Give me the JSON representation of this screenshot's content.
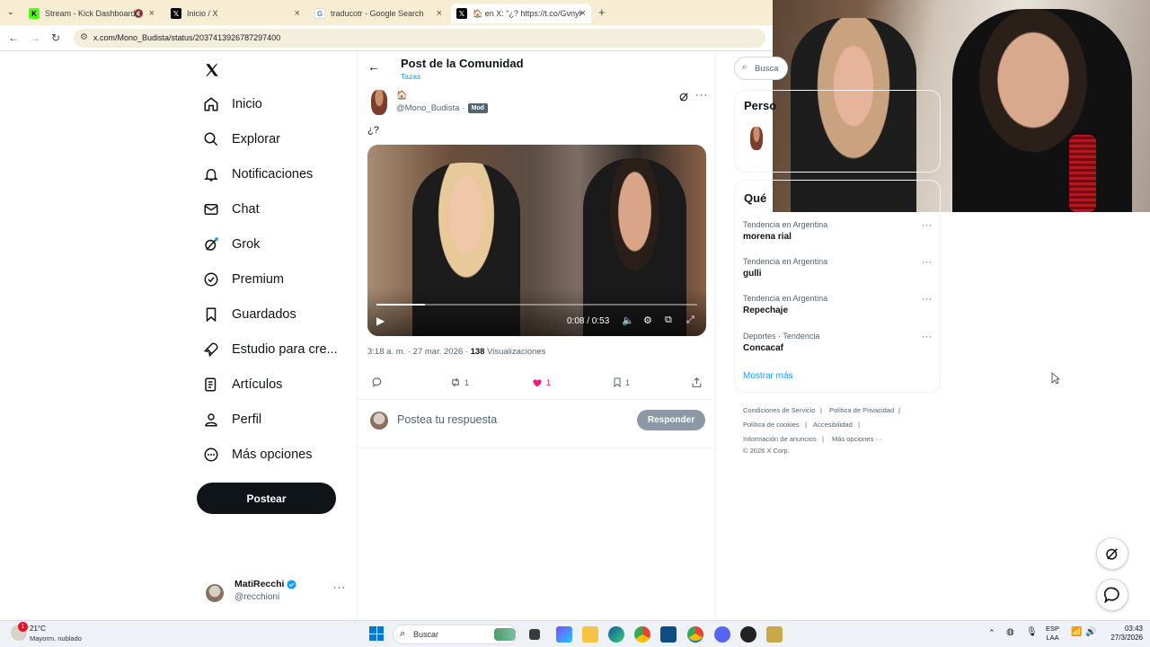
{
  "browser": {
    "tabs": [
      {
        "label": "Stream - Kick Dashboard",
        "favicon": "kick-icon"
      },
      {
        "label": "Inicio / X",
        "favicon": "x-icon"
      },
      {
        "label": "traducotr - Google Search",
        "favicon": "google-icon"
      },
      {
        "label": "🏠 en X: \"¿? https://t.co/GvnyK",
        "favicon": "x-icon"
      }
    ],
    "url": "x.com/Mono_Budista/status/2037413926787297400"
  },
  "nav": {
    "items": [
      {
        "label": "Inicio",
        "icon": "home-icon"
      },
      {
        "label": "Explorar",
        "icon": "search-icon"
      },
      {
        "label": "Notificaciones",
        "icon": "bell-icon"
      },
      {
        "label": "Chat",
        "icon": "mail-icon"
      },
      {
        "label": "Grok",
        "icon": "grok-icon"
      },
      {
        "label": "Premium",
        "icon": "verified-icon"
      },
      {
        "label": "Guardados",
        "icon": "bookmark-icon"
      },
      {
        "label": "Estudio para cre...",
        "icon": "rocket-icon"
      },
      {
        "label": "Artículos",
        "icon": "article-icon"
      },
      {
        "label": "Perfil",
        "icon": "person-icon"
      },
      {
        "label": "Más opciones",
        "icon": "more-circle-icon"
      }
    ],
    "post_button": "Postear",
    "account": {
      "name": "MatiRecchi",
      "handle": "@recchioni",
      "verified": true
    }
  },
  "header": {
    "title": "Post de la Comunidad",
    "community": "Tazas"
  },
  "post": {
    "name_glyph": "🏠",
    "handle": "@Mono_Budista",
    "separator": "·",
    "badge": "Mod",
    "text": "¿?",
    "video": {
      "time": "0:08 / 0:53",
      "progress": 0.15
    },
    "time": "3:18 a. m. · 27 mar. 2026",
    "views_count": "138",
    "views_label": "Visualizaciones",
    "actions": {
      "replies": "",
      "reposts": "1",
      "likes": "1",
      "bookmarks": "1"
    },
    "reply_placeholder": "Postea tu respuesta",
    "reply_button": "Responder"
  },
  "right": {
    "search_placeholder": "Busca",
    "people_title": "Perso",
    "trends_title": "Qué",
    "trends": [
      {
        "context": "Tendencia en Argentina",
        "name": "morena rial"
      },
      {
        "context": "Tendencia en Argentina",
        "name": "gulli"
      },
      {
        "context": "Tendencia en Argentina",
        "name": "Repechaje"
      },
      {
        "context": "Deportes · Tendencia",
        "name": "Concacaf"
      }
    ],
    "show_more": "Mostrar más",
    "footer": [
      "Condiciones de Servicio",
      "|",
      "Política de Privacidad",
      "|",
      "Política de cookies",
      "|",
      "Accesibilidad",
      "|",
      "Información de anuncios",
      "|",
      "Más opciones ···",
      "© 2026 X Corp."
    ]
  },
  "taskbar": {
    "weather_temp": "21°C",
    "weather_desc": "Mayorm. nublado",
    "weather_badge": "1",
    "search": "Buscar",
    "lang1": "ESP",
    "lang2": "LAA",
    "time": "03:43",
    "date": "27/3/2026"
  },
  "colors": {
    "like": "#f91880",
    "accent": "#1d9bf0",
    "primary": "#0f1419"
  }
}
